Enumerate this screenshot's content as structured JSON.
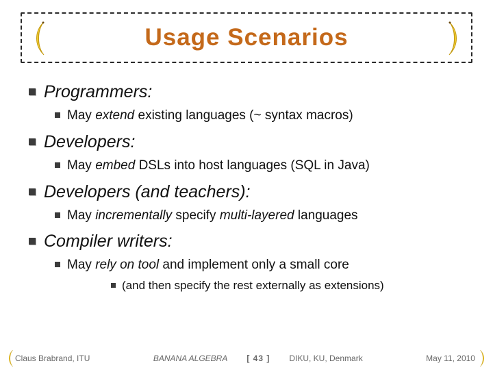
{
  "title": "Usage Scenarios",
  "sections": [
    {
      "heading_upright": "Programmers",
      "heading_suffix": ":",
      "point_pre": "May ",
      "point_emph": "extend",
      "point_post": " existing languages (~ syntax macros)"
    },
    {
      "heading_upright": "Developers",
      "heading_suffix": ":",
      "point_pre": "May ",
      "point_emph": "embed",
      "point_post": " DSLs into host languages (SQL in Java)"
    },
    {
      "heading_upright": "Developers",
      "heading_tail": " (and teachers):",
      "point_pre": "May ",
      "point_emph": "incrementally",
      "point_mid": " specify ",
      "point_emph2": "multi-layered",
      "point_post": " languages"
    },
    {
      "heading_upright": "Compiler writers",
      "heading_suffix": ":",
      "point_pre": "May ",
      "point_emph": "rely on tool",
      "point_post": " and implement only a small core",
      "sub": "(and then specify the rest externally as extensions)"
    }
  ],
  "footer": {
    "author": "Claus Brabrand, ITU",
    "center": "BANANA ALGEBRA",
    "page": "[ 43 ]",
    "affil": "DIKU, KU, Denmark",
    "date": "May 11, 2010"
  }
}
